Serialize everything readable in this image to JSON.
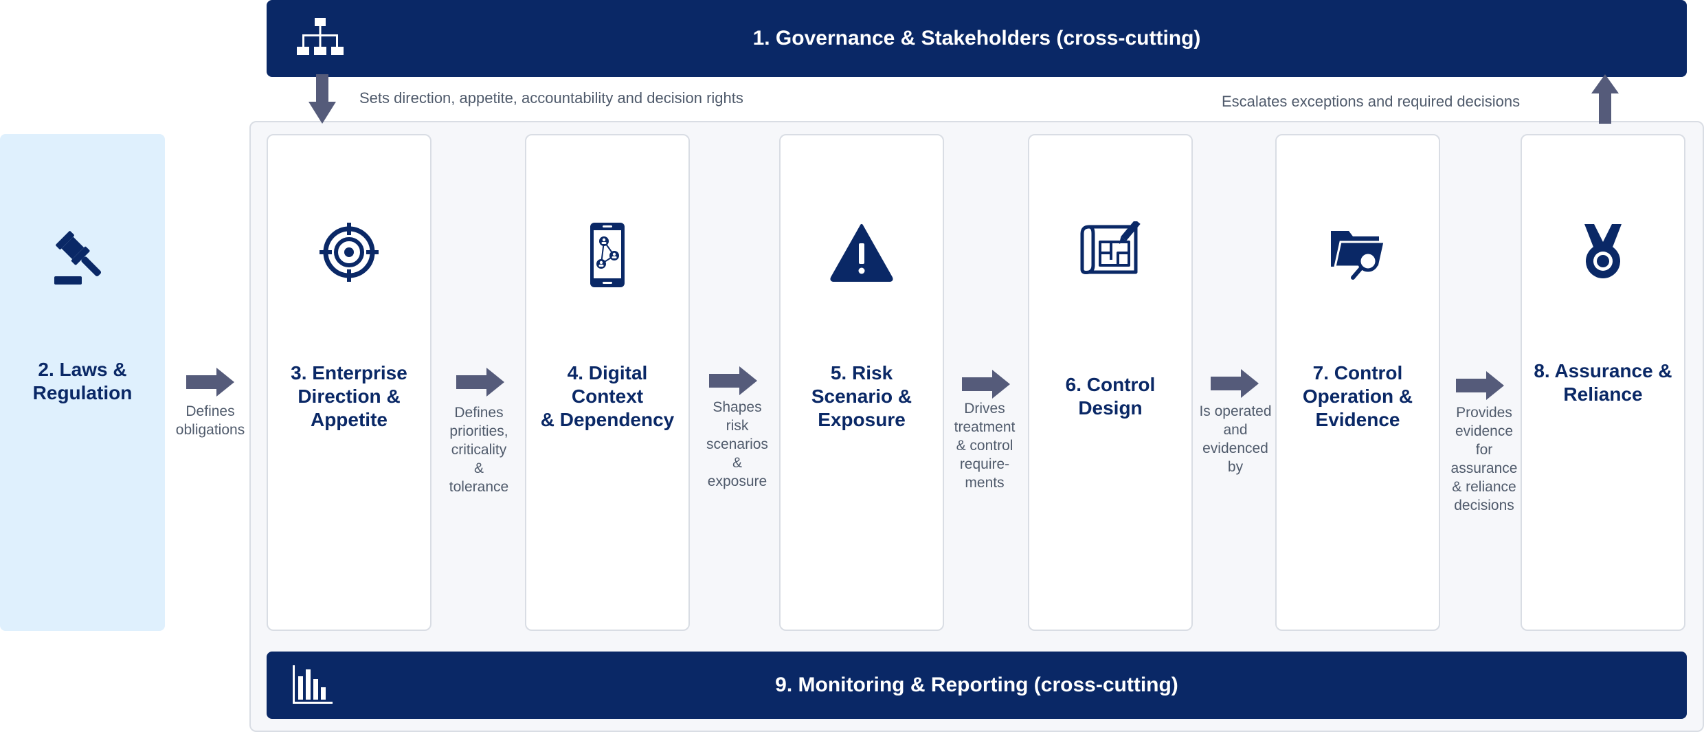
{
  "governance": {
    "title": "1. Governance & Stakeholders  (cross-cutting)",
    "icon": "org-chart-icon"
  },
  "monitoring": {
    "title": "9. Monitoring & Reporting  (cross-cutting)",
    "icon": "bar-chart-icon"
  },
  "notes": {
    "down": "Sets direction, appetite, accountability and decision rights",
    "up": "Escalates exceptions and required decisions"
  },
  "laws": {
    "title": "2. Laws &\nRegulation",
    "icon": "gavel-icon"
  },
  "stages": [
    {
      "title": "3. Enterprise\nDirection &\nAppetite",
      "icon": "target-icon"
    },
    {
      "title": "4. Digital\nContext\n& Dependency",
      "icon": "smartphone-network-icon"
    },
    {
      "title": "5. Risk\nScenario &\nExposure",
      "icon": "warning-icon"
    },
    {
      "title": "6. Control\nDesign",
      "icon": "blueprint-icon"
    },
    {
      "title": "7. Control\nOperation &\nEvidence",
      "icon": "folder-search-icon"
    },
    {
      "title": "8. Assurance &\nReliance",
      "icon": "medal-icon"
    }
  ],
  "connectors": [
    "Defines\nobligations",
    "Defines\npriorities,\ncriticality\n&\ntolerance",
    "Shapes\nrisk\nscenarios\n&\nexposure",
    "Drives\ntreatment\n& control\nrequire-\nments",
    "Is operated\nand\nevidenced\nby",
    "Provides\nevidence\nfor\nassurance\n& reliance\ndecisions"
  ],
  "colors": {
    "navy": "#0a2866",
    "arrow": "#555b7a",
    "laws_bg": "#dff0fd",
    "panel_bg": "#f6f7fa",
    "text_muted": "#4f5a6b"
  }
}
